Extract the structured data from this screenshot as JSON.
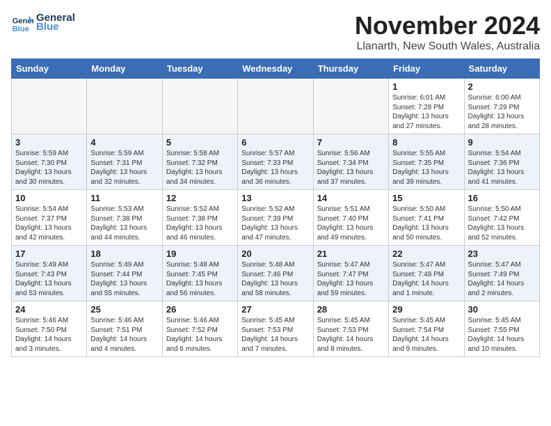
{
  "header": {
    "logo_line1": "General",
    "logo_line2": "Blue",
    "month_title": "November 2024",
    "location": "Llanarth, New South Wales, Australia"
  },
  "days_of_week": [
    "Sunday",
    "Monday",
    "Tuesday",
    "Wednesday",
    "Thursday",
    "Friday",
    "Saturday"
  ],
  "weeks": [
    [
      {
        "day": "",
        "info": ""
      },
      {
        "day": "",
        "info": ""
      },
      {
        "day": "",
        "info": ""
      },
      {
        "day": "",
        "info": ""
      },
      {
        "day": "",
        "info": ""
      },
      {
        "day": "1",
        "info": "Sunrise: 6:01 AM\nSunset: 7:28 PM\nDaylight: 13 hours\nand 27 minutes."
      },
      {
        "day": "2",
        "info": "Sunrise: 6:00 AM\nSunset: 7:29 PM\nDaylight: 13 hours\nand 28 minutes."
      }
    ],
    [
      {
        "day": "3",
        "info": "Sunrise: 5:59 AM\nSunset: 7:30 PM\nDaylight: 13 hours\nand 30 minutes."
      },
      {
        "day": "4",
        "info": "Sunrise: 5:59 AM\nSunset: 7:31 PM\nDaylight: 13 hours\nand 32 minutes."
      },
      {
        "day": "5",
        "info": "Sunrise: 5:58 AM\nSunset: 7:32 PM\nDaylight: 13 hours\nand 34 minutes."
      },
      {
        "day": "6",
        "info": "Sunrise: 5:57 AM\nSunset: 7:33 PM\nDaylight: 13 hours\nand 36 minutes."
      },
      {
        "day": "7",
        "info": "Sunrise: 5:56 AM\nSunset: 7:34 PM\nDaylight: 13 hours\nand 37 minutes."
      },
      {
        "day": "8",
        "info": "Sunrise: 5:55 AM\nSunset: 7:35 PM\nDaylight: 13 hours\nand 39 minutes."
      },
      {
        "day": "9",
        "info": "Sunrise: 5:54 AM\nSunset: 7:36 PM\nDaylight: 13 hours\nand 41 minutes."
      }
    ],
    [
      {
        "day": "10",
        "info": "Sunrise: 5:54 AM\nSunset: 7:37 PM\nDaylight: 13 hours\nand 42 minutes."
      },
      {
        "day": "11",
        "info": "Sunrise: 5:53 AM\nSunset: 7:38 PM\nDaylight: 13 hours\nand 44 minutes."
      },
      {
        "day": "12",
        "info": "Sunrise: 5:52 AM\nSunset: 7:38 PM\nDaylight: 13 hours\nand 46 minutes."
      },
      {
        "day": "13",
        "info": "Sunrise: 5:52 AM\nSunset: 7:39 PM\nDaylight: 13 hours\nand 47 minutes."
      },
      {
        "day": "14",
        "info": "Sunrise: 5:51 AM\nSunset: 7:40 PM\nDaylight: 13 hours\nand 49 minutes."
      },
      {
        "day": "15",
        "info": "Sunrise: 5:50 AM\nSunset: 7:41 PM\nDaylight: 13 hours\nand 50 minutes."
      },
      {
        "day": "16",
        "info": "Sunrise: 5:50 AM\nSunset: 7:42 PM\nDaylight: 13 hours\nand 52 minutes."
      }
    ],
    [
      {
        "day": "17",
        "info": "Sunrise: 5:49 AM\nSunset: 7:43 PM\nDaylight: 13 hours\nand 53 minutes."
      },
      {
        "day": "18",
        "info": "Sunrise: 5:49 AM\nSunset: 7:44 PM\nDaylight: 13 hours\nand 55 minutes."
      },
      {
        "day": "19",
        "info": "Sunrise: 5:48 AM\nSunset: 7:45 PM\nDaylight: 13 hours\nand 56 minutes."
      },
      {
        "day": "20",
        "info": "Sunrise: 5:48 AM\nSunset: 7:46 PM\nDaylight: 13 hours\nand 58 minutes."
      },
      {
        "day": "21",
        "info": "Sunrise: 5:47 AM\nSunset: 7:47 PM\nDaylight: 13 hours\nand 59 minutes."
      },
      {
        "day": "22",
        "info": "Sunrise: 5:47 AM\nSunset: 7:48 PM\nDaylight: 14 hours\nand 1 minute."
      },
      {
        "day": "23",
        "info": "Sunrise: 5:47 AM\nSunset: 7:49 PM\nDaylight: 14 hours\nand 2 minutes."
      }
    ],
    [
      {
        "day": "24",
        "info": "Sunrise: 5:46 AM\nSunset: 7:50 PM\nDaylight: 14 hours\nand 3 minutes."
      },
      {
        "day": "25",
        "info": "Sunrise: 5:46 AM\nSunset: 7:51 PM\nDaylight: 14 hours\nand 4 minutes."
      },
      {
        "day": "26",
        "info": "Sunrise: 5:46 AM\nSunset: 7:52 PM\nDaylight: 14 hours\nand 6 minutes."
      },
      {
        "day": "27",
        "info": "Sunrise: 5:45 AM\nSunset: 7:53 PM\nDaylight: 14 hours\nand 7 minutes."
      },
      {
        "day": "28",
        "info": "Sunrise: 5:45 AM\nSunset: 7:53 PM\nDaylight: 14 hours\nand 8 minutes."
      },
      {
        "day": "29",
        "info": "Sunrise: 5:45 AM\nSunset: 7:54 PM\nDaylight: 14 hours\nand 9 minutes."
      },
      {
        "day": "30",
        "info": "Sunrise: 5:45 AM\nSunset: 7:55 PM\nDaylight: 14 hours\nand 10 minutes."
      }
    ]
  ]
}
